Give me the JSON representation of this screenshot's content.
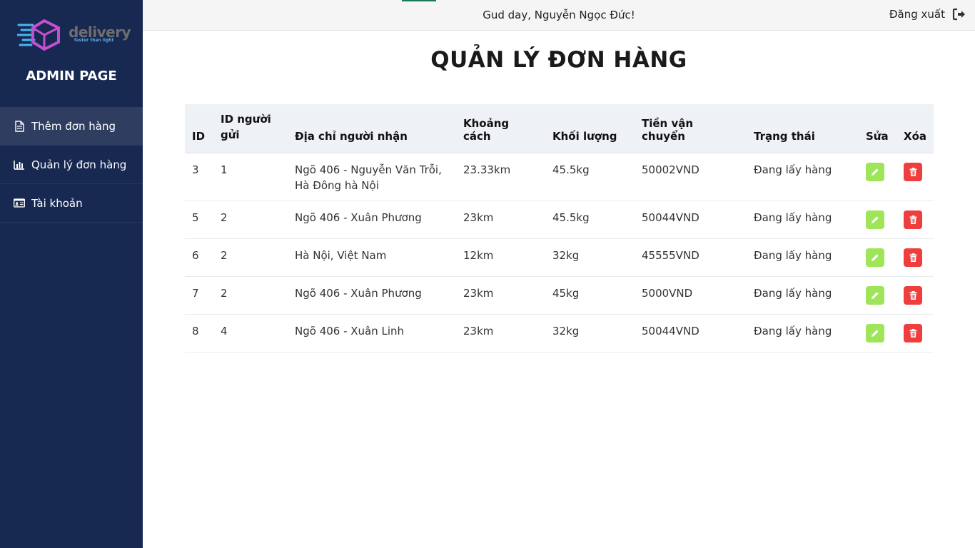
{
  "brand": {
    "name": "delivery",
    "tagline": "faster than light"
  },
  "sidebar": {
    "title": "ADMIN PAGE",
    "items": [
      {
        "label": "Thêm đơn hàng",
        "icon": "document-icon",
        "active": true
      },
      {
        "label": "Quản lý đơn hàng",
        "icon": "bar-chart-icon",
        "active": false
      },
      {
        "label": "Tài khoản",
        "icon": "id-card-icon",
        "active": false
      }
    ]
  },
  "topbar": {
    "greeting": "Gud day, Nguyễn Ngọc Đức!",
    "logout_label": "Đăng xuất",
    "logout_icon": "sign-out-icon"
  },
  "main": {
    "title": "QUẢN LÝ ĐƠN HÀNG",
    "table": {
      "headers": [
        "ID",
        "ID người gửi",
        "Địa chỉ người nhận",
        "Khoảng cách",
        "Khối lượng",
        "Tiền vận chuyển",
        "Trạng thái",
        "Sửa",
        "Xóa"
      ],
      "rows": [
        {
          "id": "3",
          "sender_id": "1",
          "address": "Ngõ 406 - Nguyễn Văn Trỗi, Hà Đông hà Nội",
          "distance": "23.33km",
          "weight": "45.5kg",
          "fee": "50002VND",
          "status": "Đang lấy hàng"
        },
        {
          "id": "5",
          "sender_id": "2",
          "address": "Ngõ 406 - Xuân Phương",
          "distance": "23km",
          "weight": "45.5kg",
          "fee": "50044VND",
          "status": "Đang lấy hàng"
        },
        {
          "id": "6",
          "sender_id": "2",
          "address": "Hà Nội, Việt Nam",
          "distance": "12km",
          "weight": "32kg",
          "fee": "45555VND",
          "status": "Đang lấy hàng"
        },
        {
          "id": "7",
          "sender_id": "2",
          "address": "Ngõ 406 - Xuân Phương",
          "distance": "23km",
          "weight": "45kg",
          "fee": "5000VND",
          "status": "Đang lấy hàng"
        },
        {
          "id": "8",
          "sender_id": "4",
          "address": "Ngõ 406 - Xuân Linh",
          "distance": "23km",
          "weight": "32kg",
          "fee": "50044VND",
          "status": "Đang lấy hàng"
        }
      ]
    }
  },
  "colors": {
    "sidebar_bg": "#172851",
    "edit_button": "#9ee55a",
    "delete_button": "#ee3e3e"
  }
}
